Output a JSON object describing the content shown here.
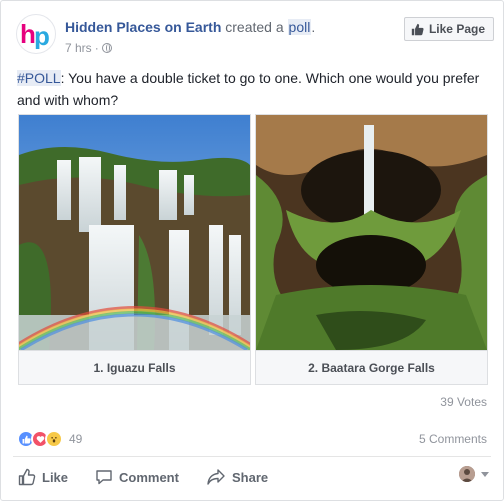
{
  "post": {
    "page_name": "Hidden Places on Earth",
    "action_text": "created a",
    "poll_link": "poll",
    "period": ".",
    "time": "7 hrs",
    "meta_sep": "·",
    "like_page_label": "Like Page",
    "hashtag": "#POLL",
    "text": ": You have a double ticket to go to one. Which one would you prefer and with whom?"
  },
  "poll": {
    "options": [
      {
        "label": "1. Iguazu Falls"
      },
      {
        "label": "2. Baatara Gorge Falls"
      }
    ],
    "votes": "39 Votes"
  },
  "engagement": {
    "reaction_count": "49",
    "comments": "5 Comments"
  },
  "actions": {
    "like": "Like",
    "comment": "Comment",
    "share": "Share"
  },
  "colors": {
    "link": "#365899",
    "brand": "#4267b2",
    "muted": "#90949c"
  }
}
